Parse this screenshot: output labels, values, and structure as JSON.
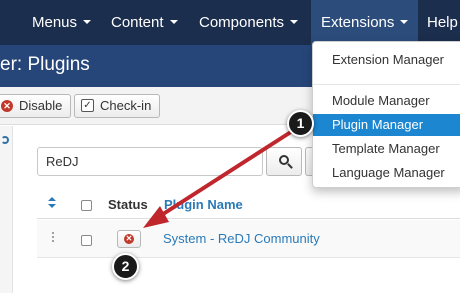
{
  "navbar": {
    "items": [
      {
        "label": "Menus"
      },
      {
        "label": "Content"
      },
      {
        "label": "Components"
      },
      {
        "label": "Extensions"
      },
      {
        "label": "Help"
      }
    ]
  },
  "titlebar": {
    "title": "er: Plugins"
  },
  "toolbar": {
    "disable_label": "Disable",
    "checkin_label": "Check-in"
  },
  "search": {
    "value": "ReDJ"
  },
  "table": {
    "headers": {
      "status": "Status",
      "name": "Plugin Name"
    },
    "rows": [
      {
        "name": "System - ReDJ Community",
        "status_icon": "unpublished-x-icon"
      }
    ]
  },
  "dropdown": {
    "items": [
      {
        "label": "Extension Manager"
      },
      {
        "label": "Module Manager"
      },
      {
        "label": "Plugin Manager"
      },
      {
        "label": "Template Manager"
      },
      {
        "label": "Language Manager"
      }
    ],
    "active_index": 2
  },
  "callouts": {
    "step1": "1",
    "step2": "2"
  },
  "colors": {
    "navbar": "#1c2e4d",
    "titlebar": "#26467a",
    "active_menu": "#1c86d0",
    "arrow": "#c0272d",
    "link": "#2a7ab8"
  }
}
